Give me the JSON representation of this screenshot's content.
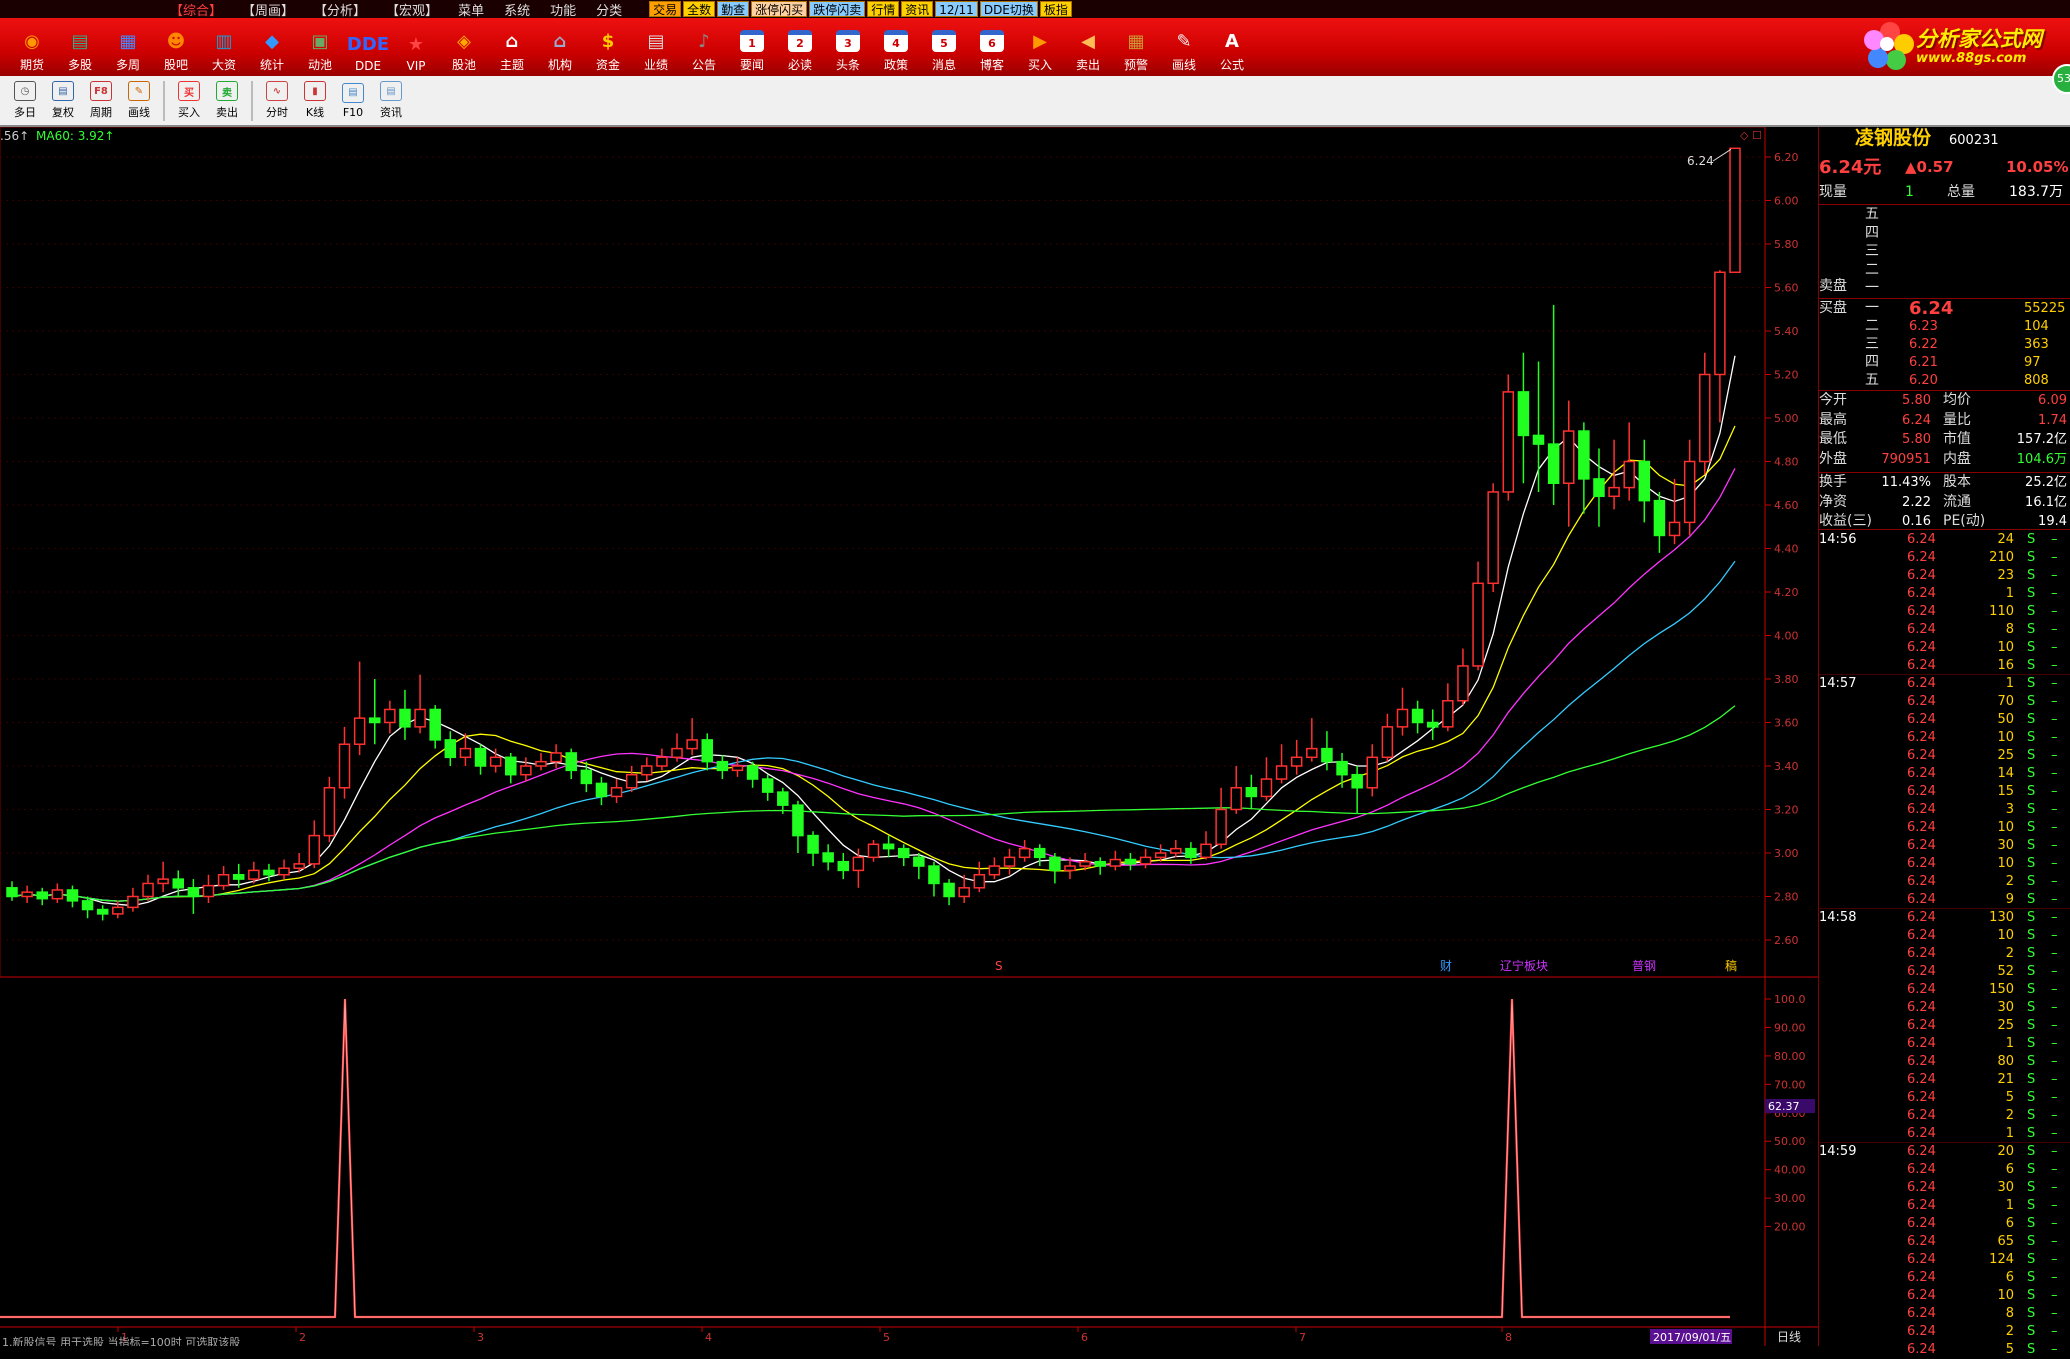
{
  "menubar": {
    "items": [
      "【综合】",
      "【周画】",
      "【分析】",
      "【宏观】",
      "菜单",
      "系统",
      "功能",
      "分类"
    ],
    "tabs": [
      {
        "label": "交易",
        "bg": "#ffa000"
      },
      {
        "label": "全数",
        "bg": "#ffd000"
      },
      {
        "label": "勤查",
        "bg": "#8cf"
      },
      {
        "label": "涨停闪买",
        "bg": "#ffd0a0"
      },
      {
        "label": "跌停闪卖",
        "bg": "#8cf"
      },
      {
        "label": "行情",
        "bg": "#ffd000"
      },
      {
        "label": "资讯",
        "bg": "#ffd000"
      },
      {
        "label": "12/11",
        "bg": "#8cf"
      },
      {
        "label": "DDE切换",
        "bg": "#8cf"
      },
      {
        "label": "板指",
        "bg": "#ffd000"
      }
    ]
  },
  "toolbar1": [
    {
      "label": "期货",
      "icon": "futures-icon",
      "color": "#f90",
      "glyph": "◉"
    },
    {
      "label": "多股",
      "icon": "multi-stock-icon",
      "color": "#3a8",
      "glyph": "▤"
    },
    {
      "label": "多周",
      "icon": "multi-period-icon",
      "color": "#48f",
      "glyph": "▦"
    },
    {
      "label": "股吧",
      "icon": "forum-icon",
      "color": "#f80",
      "glyph": "☻"
    },
    {
      "label": "大资",
      "icon": "capital-icon",
      "color": "#29c",
      "glyph": "▥"
    },
    {
      "label": "统计",
      "icon": "statistics-icon",
      "color": "#39f",
      "glyph": "◆"
    },
    {
      "label": "动池",
      "icon": "dynamic-pool-icon",
      "color": "#6a6",
      "glyph": "▣"
    },
    {
      "label": "DDE",
      "icon": "dde-icon",
      "color": "#36f",
      "glyph": "DDE"
    },
    {
      "label": "VIP",
      "icon": "vip-icon",
      "color": "#f44",
      "glyph": "★"
    },
    {
      "label": "股池",
      "icon": "stock-pool-icon",
      "color": "#fa0",
      "glyph": "◈"
    },
    {
      "label": "主题",
      "icon": "theme-icon",
      "color": "#fff",
      "glyph": "⌂"
    },
    {
      "label": "机构",
      "icon": "institution-icon",
      "color": "#9ac",
      "glyph": "⌂"
    },
    {
      "label": "资金",
      "icon": "funds-icon",
      "color": "#fc0",
      "glyph": "$"
    },
    {
      "label": "业绩",
      "icon": "performance-icon",
      "color": "#ddd",
      "glyph": "▤"
    },
    {
      "label": "公告",
      "icon": "announcement-icon",
      "color": "#888",
      "glyph": "♪"
    },
    {
      "label": "要闻",
      "icon": "news-1-icon",
      "color": "#fff",
      "glyph": "1"
    },
    {
      "label": "必读",
      "icon": "must-read-2-icon",
      "color": "#fff",
      "glyph": "2"
    },
    {
      "label": "头条",
      "icon": "headline-3-icon",
      "color": "#fff",
      "glyph": "3"
    },
    {
      "label": "政策",
      "icon": "policy-4-icon",
      "color": "#fff",
      "glyph": "4"
    },
    {
      "label": "消息",
      "icon": "message-5-icon",
      "color": "#fff",
      "glyph": "5"
    },
    {
      "label": "博客",
      "icon": "blog-6-icon",
      "color": "#fff",
      "glyph": "6"
    },
    {
      "label": "买入",
      "icon": "buy-icon",
      "color": "#f90",
      "glyph": "▶"
    },
    {
      "label": "卖出",
      "icon": "sell-icon",
      "color": "#fb5",
      "glyph": "◀"
    },
    {
      "label": "预警",
      "icon": "alert-icon",
      "color": "#c93",
      "glyph": "▦"
    },
    {
      "label": "画线",
      "icon": "draw-line-icon",
      "color": "#eee",
      "glyph": "✎"
    },
    {
      "label": "公式",
      "icon": "formula-icon",
      "color": "#fff",
      "glyph": "A"
    }
  ],
  "logo": {
    "title": "分析家公式网",
    "url_text": "www.88gs.com"
  },
  "badge": "53",
  "toolbar2": [
    {
      "label": "多日",
      "icon": "multi-day-icon",
      "color": "#555",
      "glyph": "◷"
    },
    {
      "label": "复权",
      "icon": "restore-rights-icon",
      "color": "#36a",
      "glyph": "▤"
    },
    {
      "label": "周期",
      "icon": "period-icon",
      "color": "#c33",
      "glyph": "F8"
    },
    {
      "label": "画线",
      "icon": "draw-icon",
      "color": "#c60",
      "glyph": "✎"
    },
    {
      "sep": true
    },
    {
      "label": "买入",
      "icon": "buy-order-icon",
      "color": "#e33",
      "glyph": "买"
    },
    {
      "label": "卖出",
      "icon": "sell-order-icon",
      "color": "#2a3",
      "glyph": "卖"
    },
    {
      "sep": true
    },
    {
      "label": "分时",
      "icon": "intraday-icon",
      "color": "#c44",
      "glyph": "∿"
    },
    {
      "label": "K线",
      "icon": "kline-icon",
      "color": "#c33",
      "glyph": "▮"
    },
    {
      "label": "F10",
      "icon": "f10-icon",
      "color": "#48c",
      "glyph": "▤"
    },
    {
      "label": "资讯",
      "icon": "info-icon",
      "color": "#69c",
      "glyph": "▤"
    }
  ],
  "chart": {
    "ma_label_left": ".56↑",
    "ma60_label": "MA60: 3.92↑",
    "price_axis": [
      "6.20",
      "6.00",
      "5.80",
      "5.60",
      "5.40",
      "5.20",
      "5.00",
      "4.80",
      "4.60",
      "4.40",
      "4.20",
      "4.00",
      "3.80",
      "3.60",
      "3.40",
      "3.20",
      "3.00",
      "2.80",
      "2.60"
    ],
    "last_price_label": "6.24",
    "indicator_axis": [
      "100.0",
      "90.00",
      "80.00",
      "70.00",
      "60.00",
      "50.00",
      "40.00",
      "30.00",
      "20.00"
    ],
    "indicator_value": "62.37",
    "date_label": "2017/09/01/五",
    "period_label": "日线",
    "x_marks": [
      "1",
      "2",
      "3",
      "4",
      "5",
      "6",
      "7",
      "8"
    ],
    "events": [
      {
        "text": "S",
        "color": "#f44"
      },
      {
        "text": "财",
        "color": "#39f"
      },
      {
        "text": "辽宁板块",
        "color": "#c3f"
      },
      {
        "text": "普钢",
        "color": "#c3f"
      },
      {
        "text": "稿",
        "color": "#fc0"
      }
    ],
    "bottom_text": "1.新股信号 用于选股 当指标=100时 可选取该股"
  },
  "chart_data": {
    "type": "candlestick",
    "price_ylim": [
      2.6,
      6.24
    ],
    "indicator_ylim": [
      0,
      100
    ],
    "indicator_spikes": [
      100,
      100
    ],
    "candles": [
      [
        2.84,
        2.8,
        2.87,
        2.78
      ],
      [
        2.8,
        2.82,
        2.85,
        2.77
      ],
      [
        2.82,
        2.79,
        2.84,
        2.76
      ],
      [
        2.79,
        2.83,
        2.86,
        2.77
      ],
      [
        2.83,
        2.78,
        2.85,
        2.75
      ],
      [
        2.78,
        2.74,
        2.8,
        2.7
      ],
      [
        2.74,
        2.72,
        2.76,
        2.69
      ],
      [
        2.72,
        2.75,
        2.78,
        2.7
      ],
      [
        2.75,
        2.8,
        2.84,
        2.73
      ],
      [
        2.8,
        2.86,
        2.9,
        2.78
      ],
      [
        2.86,
        2.88,
        2.96,
        2.82
      ],
      [
        2.88,
        2.84,
        2.92,
        2.8
      ],
      [
        2.84,
        2.8,
        2.88,
        2.72
      ],
      [
        2.8,
        2.85,
        2.9,
        2.77
      ],
      [
        2.85,
        2.9,
        2.94,
        2.83
      ],
      [
        2.9,
        2.88,
        2.95,
        2.84
      ],
      [
        2.88,
        2.92,
        2.96,
        2.86
      ],
      [
        2.92,
        2.9,
        2.95,
        2.87
      ],
      [
        2.9,
        2.93,
        2.97,
        2.88
      ],
      [
        2.93,
        2.95,
        3.0,
        2.91
      ],
      [
        2.95,
        3.08,
        3.15,
        2.93
      ],
      [
        3.08,
        3.3,
        3.35,
        3.05
      ],
      [
        3.3,
        3.5,
        3.58,
        3.25
      ],
      [
        3.5,
        3.62,
        3.88,
        3.45
      ],
      [
        3.62,
        3.6,
        3.8,
        3.5
      ],
      [
        3.6,
        3.66,
        3.7,
        3.55
      ],
      [
        3.66,
        3.58,
        3.75,
        3.52
      ],
      [
        3.58,
        3.66,
        3.82,
        3.55
      ],
      [
        3.66,
        3.52,
        3.68,
        3.48
      ],
      [
        3.52,
        3.44,
        3.56,
        3.4
      ],
      [
        3.44,
        3.48,
        3.55,
        3.4
      ],
      [
        3.48,
        3.4,
        3.5,
        3.36
      ],
      [
        3.4,
        3.44,
        3.48,
        3.37
      ],
      [
        3.44,
        3.36,
        3.46,
        3.32
      ],
      [
        3.36,
        3.4,
        3.44,
        3.33
      ],
      [
        3.4,
        3.42,
        3.46,
        3.38
      ],
      [
        3.42,
        3.46,
        3.5,
        3.39
      ],
      [
        3.46,
        3.38,
        3.48,
        3.34
      ],
      [
        3.38,
        3.32,
        3.42,
        3.28
      ],
      [
        3.32,
        3.26,
        3.35,
        3.22
      ],
      [
        3.26,
        3.3,
        3.34,
        3.23
      ],
      [
        3.3,
        3.36,
        3.4,
        3.28
      ],
      [
        3.36,
        3.4,
        3.44,
        3.33
      ],
      [
        3.4,
        3.44,
        3.48,
        3.38
      ],
      [
        3.44,
        3.48,
        3.55,
        3.42
      ],
      [
        3.48,
        3.52,
        3.62,
        3.45
      ],
      [
        3.52,
        3.42,
        3.55,
        3.38
      ],
      [
        3.42,
        3.38,
        3.45,
        3.34
      ],
      [
        3.38,
        3.4,
        3.44,
        3.35
      ],
      [
        3.4,
        3.34,
        3.42,
        3.3
      ],
      [
        3.34,
        3.28,
        3.36,
        3.24
      ],
      [
        3.28,
        3.22,
        3.3,
        3.18
      ],
      [
        3.22,
        3.08,
        3.24,
        3.0
      ],
      [
        3.08,
        3.0,
        3.1,
        2.94
      ],
      [
        3.0,
        2.96,
        3.04,
        2.92
      ],
      [
        2.96,
        2.92,
        3.0,
        2.88
      ],
      [
        2.92,
        2.98,
        3.02,
        2.84
      ],
      [
        2.98,
        3.04,
        3.06,
        2.96
      ],
      [
        3.04,
        3.02,
        3.08,
        2.98
      ],
      [
        3.02,
        2.98,
        3.04,
        2.94
      ],
      [
        2.98,
        2.94,
        3.0,
        2.88
      ],
      [
        2.94,
        2.86,
        2.96,
        2.8
      ],
      [
        2.86,
        2.8,
        2.88,
        2.76
      ],
      [
        2.8,
        2.84,
        2.9,
        2.77
      ],
      [
        2.84,
        2.9,
        2.96,
        2.82
      ],
      [
        2.9,
        2.94,
        2.98,
        2.88
      ],
      [
        2.94,
        2.98,
        3.02,
        2.9
      ],
      [
        2.98,
        3.02,
        3.06,
        2.96
      ],
      [
        3.02,
        2.98,
        3.04,
        2.94
      ],
      [
        2.98,
        2.92,
        3.0,
        2.86
      ],
      [
        2.92,
        2.94,
        2.98,
        2.88
      ],
      [
        2.94,
        2.96,
        3.0,
        2.92
      ],
      [
        2.96,
        2.94,
        2.98,
        2.9
      ],
      [
        2.94,
        2.97,
        3.01,
        2.92
      ],
      [
        2.97,
        2.95,
        3.0,
        2.92
      ],
      [
        2.95,
        2.98,
        3.02,
        2.93
      ],
      [
        2.98,
        3.0,
        3.04,
        2.96
      ],
      [
        3.0,
        3.02,
        3.06,
        2.98
      ],
      [
        3.02,
        2.98,
        3.05,
        2.95
      ],
      [
        2.98,
        3.04,
        3.1,
        2.97
      ],
      [
        3.04,
        3.2,
        3.3,
        3.02
      ],
      [
        3.2,
        3.3,
        3.4,
        3.18
      ],
      [
        3.3,
        3.26,
        3.36,
        3.2
      ],
      [
        3.26,
        3.34,
        3.44,
        3.24
      ],
      [
        3.34,
        3.4,
        3.5,
        3.32
      ],
      [
        3.4,
        3.44,
        3.52,
        3.36
      ],
      [
        3.44,
        3.48,
        3.62,
        3.42
      ],
      [
        3.48,
        3.42,
        3.56,
        3.38
      ],
      [
        3.42,
        3.36,
        3.46,
        3.3
      ],
      [
        3.36,
        3.3,
        3.4,
        3.18
      ],
      [
        3.3,
        3.44,
        3.5,
        3.26
      ],
      [
        3.44,
        3.58,
        3.64,
        3.42
      ],
      [
        3.58,
        3.66,
        3.76,
        3.54
      ],
      [
        3.66,
        3.6,
        3.7,
        3.55
      ],
      [
        3.6,
        3.58,
        3.66,
        3.52
      ],
      [
        3.58,
        3.7,
        3.78,
        3.56
      ],
      [
        3.7,
        3.86,
        3.94,
        3.68
      ],
      [
        3.86,
        4.24,
        4.34,
        3.84
      ],
      [
        4.24,
        4.66,
        4.7,
        4.2
      ],
      [
        4.66,
        5.12,
        5.2,
        4.62
      ],
      [
        5.12,
        4.92,
        5.3,
        4.7
      ],
      [
        4.92,
        4.88,
        5.26,
        4.66
      ],
      [
        4.88,
        4.7,
        5.52,
        4.6
      ],
      [
        4.7,
        4.94,
        5.08,
        4.5
      ],
      [
        4.94,
        4.72,
        4.98,
        4.56
      ],
      [
        4.72,
        4.64,
        4.86,
        4.5
      ],
      [
        4.64,
        4.68,
        4.9,
        4.58
      ],
      [
        4.68,
        4.8,
        4.98,
        4.62
      ],
      [
        4.8,
        4.62,
        4.9,
        4.52
      ],
      [
        4.62,
        4.46,
        4.66,
        4.38
      ],
      [
        4.46,
        4.52,
        4.72,
        4.42
      ],
      [
        4.52,
        4.8,
        4.9,
        4.46
      ],
      [
        4.8,
        5.2,
        5.3,
        4.74
      ],
      [
        5.2,
        5.67,
        5.68,
        4.98
      ],
      [
        5.67,
        6.24,
        6.24,
        5.8
      ]
    ]
  },
  "quote": {
    "name": "凌钢股份",
    "code": "600231",
    "price": "6.24元",
    "change": "▲0.57",
    "pct": "10.05%",
    "vol_now_label": "现量",
    "vol_now": "1",
    "vol_total_label": "总量",
    "vol_total": "183.7万",
    "sell_label": "卖盘",
    "buy_label": "买盘",
    "sell": [
      {
        "lvl": "五"
      },
      {
        "lvl": "四"
      },
      {
        "lvl": "三"
      },
      {
        "lvl": "二"
      },
      {
        "lvl": "一"
      }
    ],
    "buy": [
      {
        "lvl": "一",
        "price": "6.24",
        "vol": "55225"
      },
      {
        "lvl": "二",
        "price": "6.23",
        "vol": "104"
      },
      {
        "lvl": "三",
        "price": "6.22",
        "vol": "363"
      },
      {
        "lvl": "四",
        "price": "6.21",
        "vol": "97"
      },
      {
        "lvl": "五",
        "price": "6.20",
        "vol": "808"
      }
    ],
    "stats": [
      {
        "k1": "今开",
        "v1": "5.80",
        "k2": "均价",
        "v2": "6.09",
        "c1": "#ff4040",
        "c2": "#ff4040"
      },
      {
        "k1": "最高",
        "v1": "6.24",
        "k2": "量比",
        "v2": "1.74",
        "c1": "#ff4040",
        "c2": "#ff4040"
      },
      {
        "k1": "最低",
        "v1": "5.80",
        "k2": "市值",
        "v2": "157.2亿",
        "c1": "#ff4040",
        "c2": "#fff"
      },
      {
        "k1": "外盘",
        "v1": "790951",
        "k2": "内盘",
        "v2": "104.6万",
        "c1": "#ff4040",
        "c2": "#3f3"
      },
      {
        "k1": "换手",
        "v1": "11.43%",
        "k2": "股本",
        "v2": "25.2亿",
        "c1": "#fff",
        "c2": "#fff"
      },
      {
        "k1": "净资",
        "v1": "2.22",
        "k2": "流通",
        "v2": "16.1亿",
        "c1": "#fff",
        "c2": "#fff"
      },
      {
        "k1": "收益(三)",
        "v1": "0.16",
        "k2": "PE(动)",
        "v2": "19.4",
        "c1": "#fff",
        "c2": "#fff"
      }
    ],
    "ticks": [
      {
        "time": "14:56",
        "rows": [
          [
            "6.24",
            "24"
          ],
          [
            "6.24",
            "210"
          ],
          [
            "6.24",
            "23"
          ],
          [
            "6.24",
            "1"
          ],
          [
            "6.24",
            "110"
          ],
          [
            "6.24",
            "8"
          ],
          [
            "6.24",
            "10"
          ],
          [
            "6.24",
            "16"
          ]
        ]
      },
      {
        "time": "14:57",
        "rows": [
          [
            "6.24",
            "1"
          ],
          [
            "6.24",
            "70"
          ],
          [
            "6.24",
            "50"
          ],
          [
            "6.24",
            "10"
          ],
          [
            "6.24",
            "25"
          ],
          [
            "6.24",
            "14"
          ],
          [
            "6.24",
            "15"
          ],
          [
            "6.24",
            "3"
          ],
          [
            "6.24",
            "10"
          ],
          [
            "6.24",
            "30"
          ],
          [
            "6.24",
            "10"
          ],
          [
            "6.24",
            "2"
          ],
          [
            "6.24",
            "9"
          ]
        ]
      },
      {
        "time": "14:58",
        "rows": [
          [
            "6.24",
            "130"
          ],
          [
            "6.24",
            "10"
          ],
          [
            "6.24",
            "2"
          ],
          [
            "6.24",
            "52"
          ],
          [
            "6.24",
            "150"
          ],
          [
            "6.24",
            "30"
          ],
          [
            "6.24",
            "25"
          ],
          [
            "6.24",
            "1"
          ],
          [
            "6.24",
            "80"
          ],
          [
            "6.24",
            "21"
          ],
          [
            "6.24",
            "5"
          ],
          [
            "6.24",
            "2"
          ],
          [
            "6.24",
            "1"
          ]
        ]
      },
      {
        "time": "14:59",
        "rows": [
          [
            "6.24",
            "20"
          ],
          [
            "6.24",
            "6"
          ],
          [
            "6.24",
            "30"
          ],
          [
            "6.24",
            "1"
          ],
          [
            "6.24",
            "6"
          ],
          [
            "6.24",
            "65"
          ],
          [
            "6.24",
            "124"
          ],
          [
            "6.24",
            "6"
          ],
          [
            "6.24",
            "10"
          ],
          [
            "6.24",
            "8"
          ],
          [
            "6.24",
            "2"
          ],
          [
            "6.24",
            "5"
          ]
        ]
      }
    ],
    "tick_side": "S"
  }
}
